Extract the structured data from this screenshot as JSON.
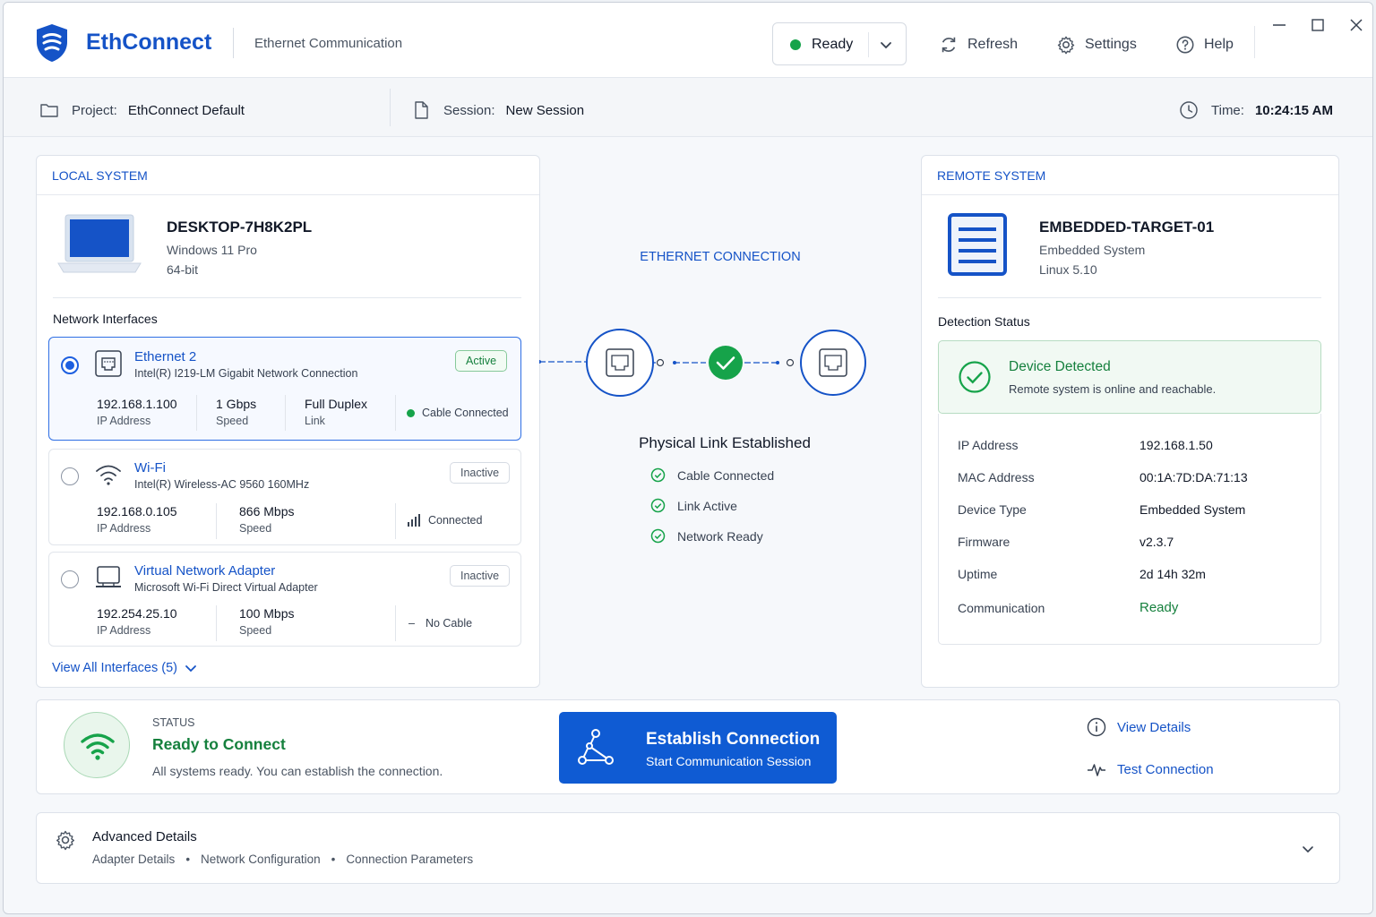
{
  "app": {
    "name": "EthConnect",
    "subtitle": "Ethernet Communication",
    "status_select": "Ready",
    "refresh_label": "Refresh",
    "settings_label": "Settings",
    "help_label": "Help",
    "brand_color": "#1553C7"
  },
  "info": {
    "project_key": "Project:",
    "project_value": "EthConnect Default",
    "session_key": "Session:",
    "session_value": "New Session",
    "time_key": "Time:",
    "time_value": "10:24:15 AM"
  },
  "local": {
    "header": "LOCAL SYSTEM",
    "name": "DESKTOP-7H8K2PL",
    "os": "Windows 11 Pro",
    "arch": "64-bit",
    "interfaces_title": "Network Interfaces",
    "interfaces": [
      {
        "name": "Ethernet 2",
        "desc": "Intel(R) I219-LM Gigabit Network Connection",
        "badge": "Active",
        "ip": "192.168.1.100",
        "ip_label": "IP Address",
        "speed": "1 Gbps",
        "speed_label": "Speed",
        "duplex": "Full Duplex",
        "duplex_label": "Link",
        "state": "Cable Connected",
        "selected": true
      },
      {
        "name": "Wi-Fi",
        "desc": "Intel(R) Wireless-AC 9560 160MHz",
        "badge": "Inactive",
        "ip": "192.168.0.105",
        "ip_label": "IP Address",
        "speed": "866 Mbps",
        "speed_label": "Speed",
        "state": "Connected",
        "selected": false
      },
      {
        "name": "Virtual Network Adapter",
        "desc": "Microsoft Wi-Fi Direct Virtual Adapter",
        "badge": "Inactive",
        "ip": "192.254.25.10",
        "ip_label": "IP Address",
        "speed": "100 Mbps",
        "speed_label": "Speed",
        "state_prefix": "–",
        "state": "No Cable",
        "selected": false
      }
    ],
    "view_all": "View All Interfaces (5)"
  },
  "connection": {
    "title": "ETHERNET CONNECTION",
    "link_title": "Physical Link Established",
    "checks": [
      "Cable Connected",
      "Link Active",
      "Network Ready"
    ]
  },
  "remote": {
    "header": "REMOTE SYSTEM",
    "name": "EMBEDDED-TARGET-01",
    "type": "Embedded System",
    "os": "Linux 5.10",
    "detection_title": "Detection Status",
    "detected_title": "Device Detected",
    "detected_desc": "Remote system is online and reachable.",
    "details": [
      {
        "k": "IP Address",
        "v": "192.168.1.50"
      },
      {
        "k": "MAC Address",
        "v": "00:1A:7D:DA:71:13"
      },
      {
        "k": "Device Type",
        "v": "Embedded System"
      },
      {
        "k": "Firmware",
        "v": "v2.3.7"
      },
      {
        "k": "Uptime",
        "v": "2d 14h 32m"
      },
      {
        "k": "Communication",
        "v": "Ready"
      }
    ]
  },
  "status": {
    "label": "STATUS",
    "title": "Ready to Connect",
    "desc": "All systems ready. You can establish the connection.",
    "button_title": "Establish Connection",
    "button_sub": "Start Communication Session",
    "view_details": "View Details",
    "test_connection": "Test Connection"
  },
  "advanced": {
    "title": "Advanced Details",
    "items": [
      "Adapter Details",
      "Network Configuration",
      "Connection Parameters"
    ],
    "separator": "•"
  },
  "colors": {
    "success": "#16A34A",
    "primary_button": "#0F5BD3"
  }
}
